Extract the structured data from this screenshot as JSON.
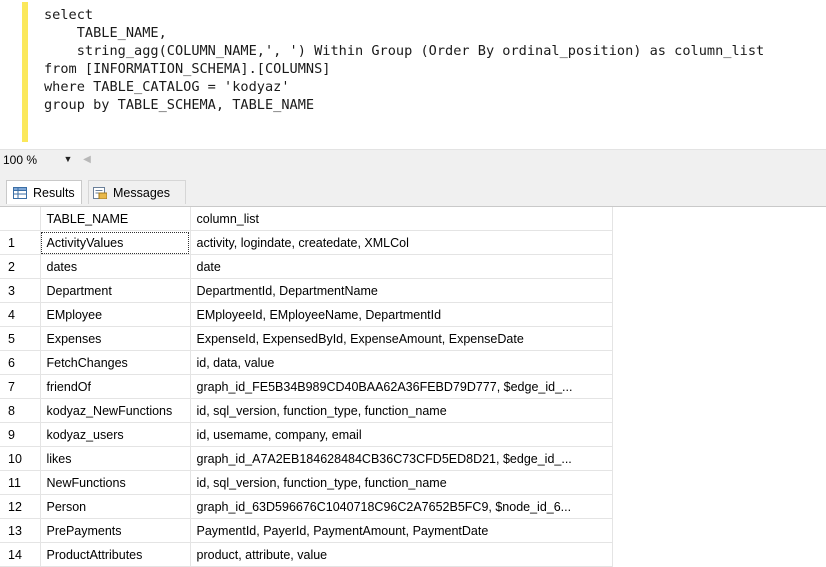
{
  "editor": {
    "lines": [
      "select",
      "    TABLE_NAME,",
      "    string_agg(COLUMN_NAME,', ') Within Group (Order By ordinal_position) as column_list",
      "from [INFORMATION_SCHEMA].[COLUMNS]",
      "where TABLE_CATALOG = 'kodyaz'",
      "group by TABLE_SCHEMA, TABLE_NAME"
    ]
  },
  "zoom": {
    "value": "100 %",
    "dropdown_icon": "chevron-down-icon",
    "scroll_icon": "scroll-left-icon"
  },
  "tabs": [
    {
      "label": "Results",
      "icon": "grid-icon"
    },
    {
      "label": "Messages",
      "icon": "messages-icon"
    }
  ],
  "grid": {
    "columns": [
      "TABLE_NAME",
      "column_list"
    ],
    "rows": [
      [
        "1",
        "ActivityValues",
        "activity, logindate, createdate, XMLCol"
      ],
      [
        "2",
        "dates",
        "date"
      ],
      [
        "3",
        "Department",
        "DepartmentId, DepartmentName"
      ],
      [
        "4",
        "EMployee",
        "EMployeeId, EMployeeName, DepartmentId"
      ],
      [
        "5",
        "Expenses",
        "ExpenseId, ExpensedById, ExpenseAmount, ExpenseDate"
      ],
      [
        "6",
        "FetchChanges",
        "id, data, value"
      ],
      [
        "7",
        "friendOf",
        "graph_id_FE5B34B989CD40BAA62A36FEBD79D777, $edge_id_..."
      ],
      [
        "8",
        "kodyaz_NewFunctions",
        "id, sql_version, function_type, function_name"
      ],
      [
        "9",
        "kodyaz_users",
        "id, usemame, company, email"
      ],
      [
        "10",
        "likes",
        "graph_id_A7A2EB184628484CB36C73CFD5ED8D21, $edge_id_..."
      ],
      [
        "11",
        "NewFunctions",
        "id, sql_version, function_type, function_name"
      ],
      [
        "12",
        "Person",
        "graph_id_63D596676C1040718C96C2A7652B5FC9, $node_id_6..."
      ],
      [
        "13",
        "PrePayments",
        "PaymentId, PayerId, PaymentAmount, PaymentDate"
      ],
      [
        "14",
        "ProductAttributes",
        "product, attribute, value"
      ]
    ]
  }
}
